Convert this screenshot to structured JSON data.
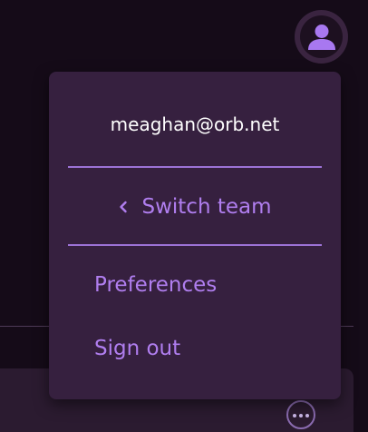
{
  "account_menu": {
    "email": "meaghan@orb.net",
    "switch_team_label": "Switch team",
    "items": [
      {
        "label": "Preferences"
      },
      {
        "label": "Sign out"
      }
    ]
  },
  "colors": {
    "background": "#150b18",
    "menu_background": "#36203f",
    "accent": "#b07eef",
    "avatar_fill": "#a878f0",
    "divider": "#9c72d6"
  },
  "icons": {
    "avatar": "user-icon",
    "switch_team": "chevron-left-icon",
    "more": "more-horizontal-icon"
  }
}
